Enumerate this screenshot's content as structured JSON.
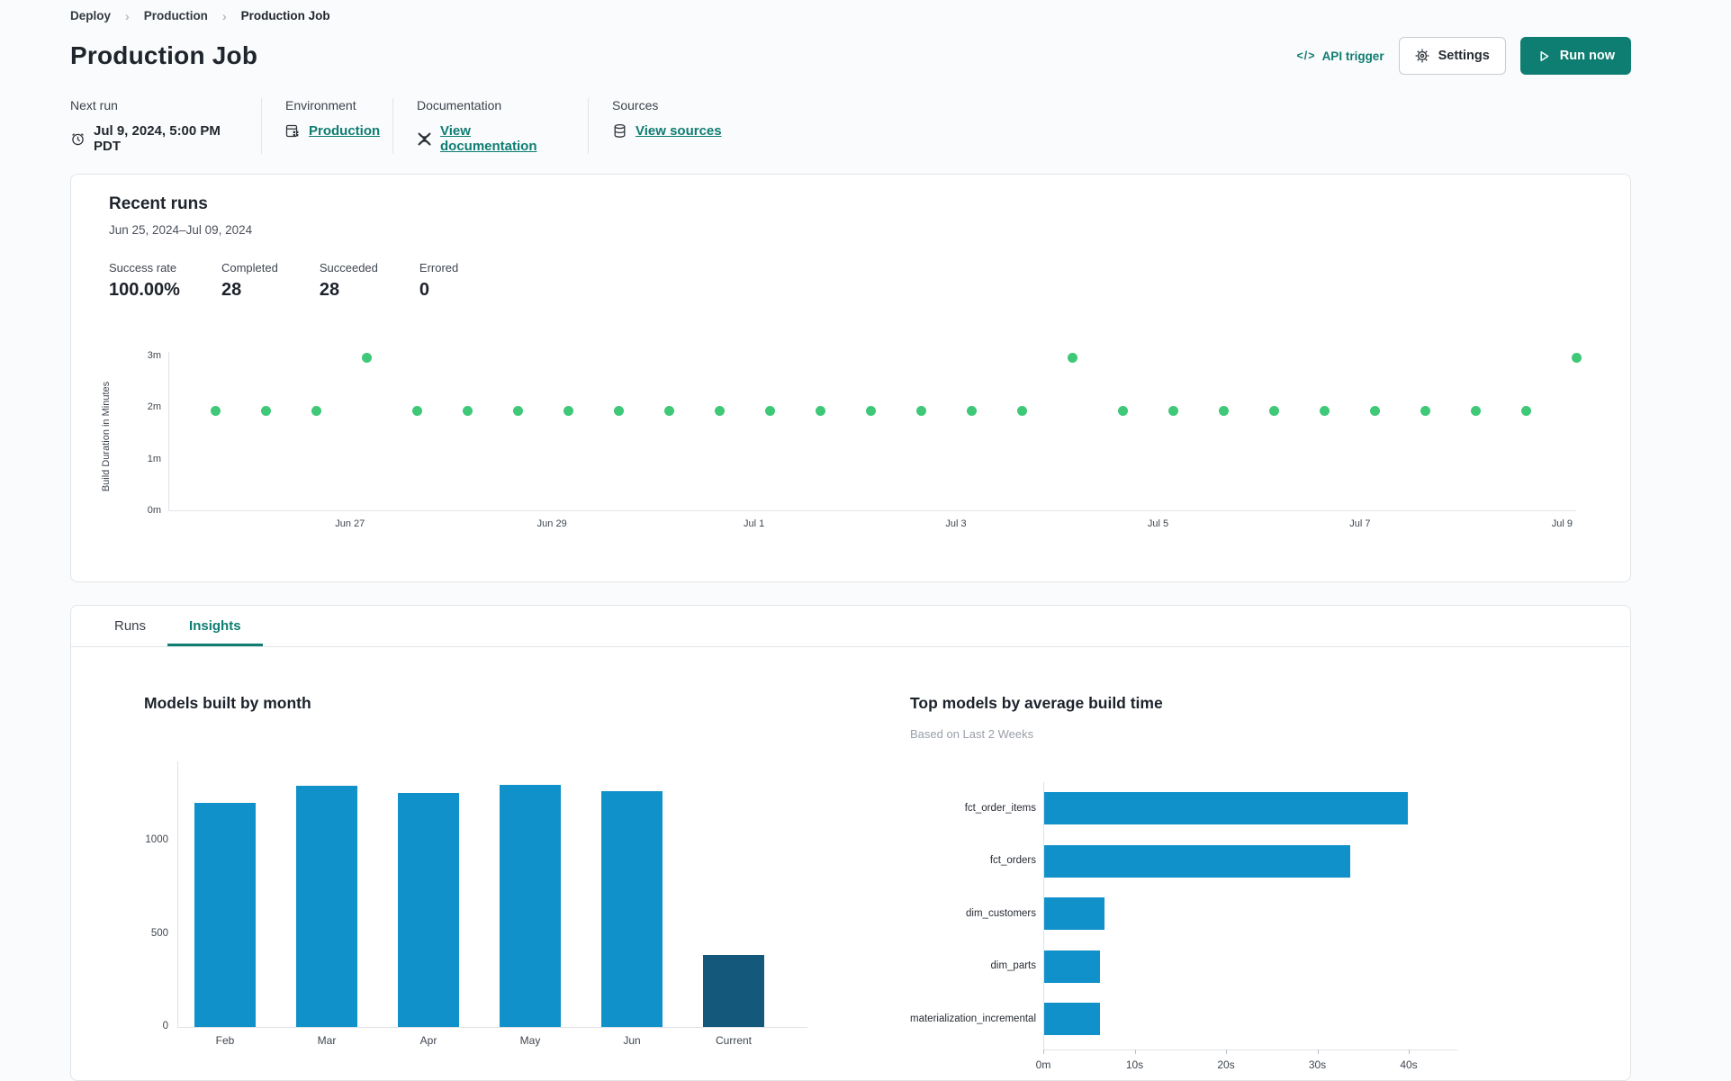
{
  "breadcrumb": {
    "items": [
      {
        "label": "Deploy"
      },
      {
        "label": "Production"
      },
      {
        "label": "Production Job"
      }
    ],
    "separator": "›"
  },
  "header": {
    "title": "Production Job",
    "api_trigger": {
      "icon": "</>",
      "label": "API trigger"
    },
    "settings_label": "Settings",
    "run_now_label": "Run now"
  },
  "job_meta": {
    "next_run": {
      "label": "Next run",
      "value": "Jul 9, 2024, 5:00 PM PDT"
    },
    "environment": {
      "label": "Environment",
      "value": "Production"
    },
    "documentation": {
      "label": "Documentation",
      "value": "View documentation"
    },
    "sources": {
      "label": "Sources",
      "value": "View sources"
    }
  },
  "recent_runs": {
    "title": "Recent runs",
    "date_range": "Jun 25, 2024–Jul 09, 2024",
    "stats": [
      {
        "label": "Success rate",
        "value": "100.00%"
      },
      {
        "label": "Completed",
        "value": "28"
      },
      {
        "label": "Succeeded",
        "value": "28"
      },
      {
        "label": "Errored",
        "value": "0"
      }
    ]
  },
  "tabs": [
    {
      "label": "Runs",
      "active": false
    },
    {
      "label": "Insights",
      "active": true
    }
  ],
  "colors": {
    "accent_teal": "#0E7D72",
    "dot_green": "#3EC878",
    "bar_blue": "#1191C9",
    "bar_dark": "#14597B"
  },
  "chart_data": [
    {
      "type": "scatter",
      "name": "recent-runs-build-duration",
      "ylabel": "Build Duration in Minutes",
      "y_ticks": [
        {
          "label": "0m",
          "value": 0
        },
        {
          "label": "1m",
          "value": 1
        },
        {
          "label": "2m",
          "value": 2
        },
        {
          "label": "3m",
          "value": 3
        }
      ],
      "ylim": [
        0,
        3.1
      ],
      "x_tick_labels": [
        "Jun 27",
        "Jun 29",
        "Jul 1",
        "Jul 3",
        "Jul 5",
        "Jul 7",
        "Jul 9"
      ],
      "point_color": "#3EC878",
      "points_minutes": [
        1.95,
        1.95,
        1.95,
        2.97,
        1.95,
        1.95,
        1.95,
        1.95,
        1.95,
        1.95,
        1.95,
        1.95,
        1.95,
        1.95,
        1.95,
        1.95,
        1.95,
        2.97,
        1.95,
        1.95,
        1.95,
        1.95,
        1.95,
        1.95,
        1.95,
        1.95,
        1.95,
        2.97
      ]
    },
    {
      "type": "bar",
      "title": "Models built by month",
      "categories": [
        "Feb",
        "Mar",
        "Apr",
        "May",
        "Jun",
        "Current"
      ],
      "values": [
        1203,
        1295,
        1256,
        1300,
        1266,
        386
      ],
      "bar_colors": [
        "#1191C9",
        "#1191C9",
        "#1191C9",
        "#1191C9",
        "#1191C9",
        "#14597B"
      ],
      "y_ticks": [
        0,
        500,
        1000
      ],
      "ylim": [
        0,
        1425
      ],
      "xlabel": "",
      "ylabel": ""
    },
    {
      "type": "bar_horizontal",
      "title": "Top models by average build time",
      "subtitle": "Based on Last 2 Weeks",
      "categories": [
        "fct_order_items",
        "fct_orders",
        "dim_customers",
        "dim_parts",
        "materialization_incremental"
      ],
      "values_seconds": [
        39.8,
        33.5,
        6.6,
        6.1,
        6.1
      ],
      "x_ticks": [
        {
          "label": "0m",
          "value": 0
        },
        {
          "label": "10s",
          "value": 10
        },
        {
          "label": "20s",
          "value": 20
        },
        {
          "label": "30s",
          "value": 30
        },
        {
          "label": "40s",
          "value": 40
        }
      ],
      "xlim": [
        0,
        44
      ],
      "bar_color": "#1191C9"
    }
  ]
}
